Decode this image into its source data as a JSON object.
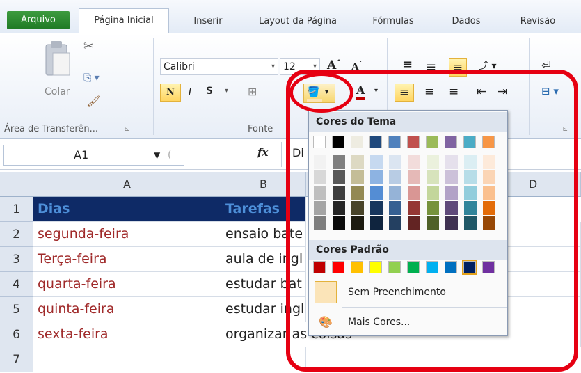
{
  "ribbon_tabs": [
    "Arquivo",
    "Página Inicial",
    "Inserir",
    "Layout da Página",
    "Fórmulas",
    "Dados",
    "Revisão"
  ],
  "clipboard": {
    "paste_label": "Colar",
    "group_label": "Área de Transferên..."
  },
  "font": {
    "name": "Calibri",
    "size": "12",
    "group_label": "Fonte",
    "bold": "N",
    "italic": "I",
    "underline": "S"
  },
  "formula_bar": {
    "cell_ref": "A1",
    "fx": "fx",
    "content": "Di"
  },
  "columns": [
    "A",
    "B",
    "C",
    "D"
  ],
  "rows": [
    "1",
    "2",
    "3",
    "4",
    "5",
    "6",
    "7"
  ],
  "sheet": {
    "header": [
      "Dias",
      "Tarefas"
    ],
    "data": [
      [
        "segunda-feira",
        "ensaio bate"
      ],
      [
        "Terça-feira",
        "aula de ingl"
      ],
      [
        "quarta-feira",
        "estudar bat"
      ],
      [
        "quinta-feira",
        "estudar ingl"
      ],
      [
        "sexta-feira",
        "organizar as coisas"
      ]
    ]
  },
  "dropdown": {
    "theme_title": "Cores do Tema",
    "standard_title": "Cores Padrão",
    "no_fill": "Sem Preenchimento",
    "more_colors": "Mais Cores...",
    "theme_colors": [
      "#ffffff",
      "#000000",
      "#eeece1",
      "#1f497d",
      "#4f81bd",
      "#c0504d",
      "#9bbb59",
      "#8064a2",
      "#4bacc6",
      "#f79646"
    ],
    "theme_tints": [
      [
        "#f2f2f2",
        "#d8d8d8",
        "#bfbfbf",
        "#a5a5a5",
        "#7f7f7f"
      ],
      [
        "#7f7f7f",
        "#595959",
        "#3f3f3f",
        "#262626",
        "#0c0c0c"
      ],
      [
        "#ddd9c3",
        "#c4bd97",
        "#938953",
        "#494429",
        "#1d1b10"
      ],
      [
        "#c6d9f0",
        "#8db3e2",
        "#548dd4",
        "#17365d",
        "#0f243e"
      ],
      [
        "#dbe5f1",
        "#b8cce4",
        "#95b3d7",
        "#366092",
        "#244061"
      ],
      [
        "#f2dcdb",
        "#e5b9b7",
        "#d99694",
        "#953734",
        "#632423"
      ],
      [
        "#ebf1dd",
        "#d7e3bc",
        "#c3d69b",
        "#76923c",
        "#4f6128"
      ],
      [
        "#e5e0ec",
        "#ccc1d9",
        "#b2a2c7",
        "#5f497a",
        "#3f3151"
      ],
      [
        "#dbeef3",
        "#b7dde8",
        "#92cddc",
        "#31859b",
        "#205867"
      ],
      [
        "#fdeada",
        "#fbd5b5",
        "#fac08f",
        "#e36c09",
        "#974806"
      ]
    ],
    "standard_colors": [
      "#c00000",
      "#ff0000",
      "#ffc000",
      "#ffff00",
      "#92d050",
      "#00b050",
      "#00b0f0",
      "#0070c0",
      "#002060",
      "#7030a0"
    ]
  },
  "annotation_color": "#e60012"
}
